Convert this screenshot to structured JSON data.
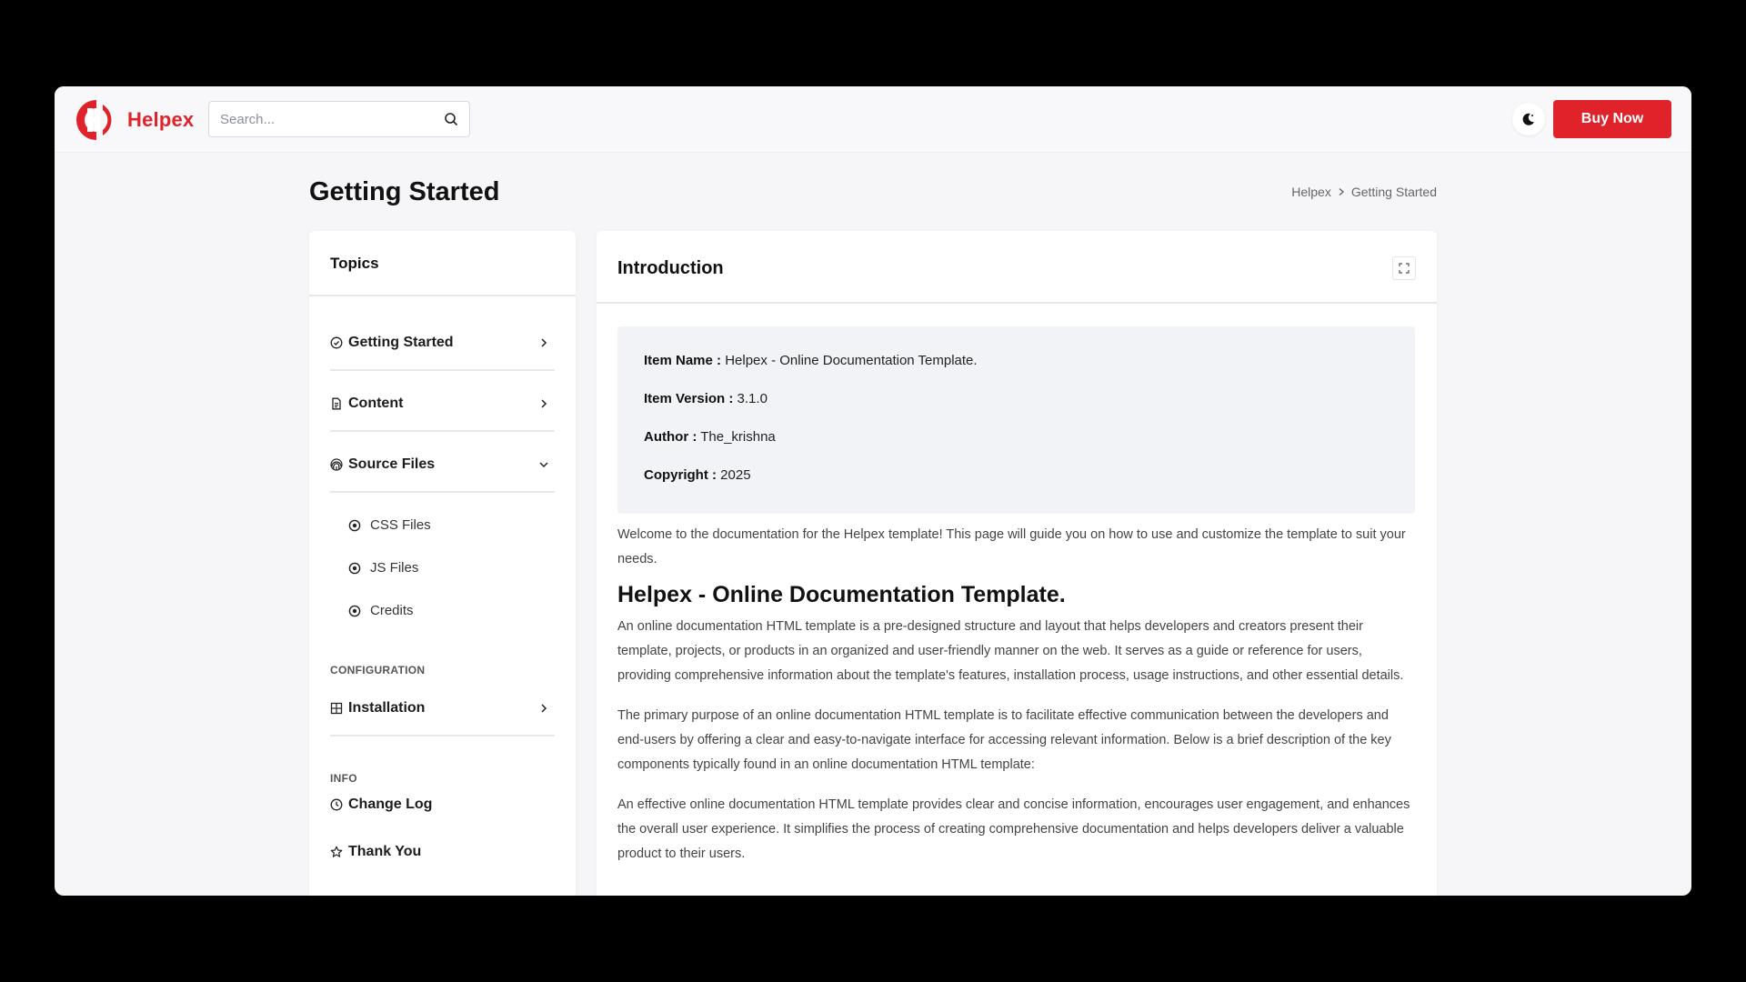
{
  "header": {
    "brand": "Helpex",
    "search_placeholder": "Search...",
    "buy_label": "Buy Now",
    "colors": {
      "accent": "#e0232b"
    }
  },
  "page": {
    "title": "Getting Started",
    "breadcrumb": [
      "Helpex",
      "Getting Started"
    ]
  },
  "sidebar": {
    "title": "Topics",
    "items": [
      {
        "label": "Getting Started",
        "icon": "clock-check-icon",
        "chevron": "chevron-right-icon"
      },
      {
        "label": "Content",
        "icon": "document-icon",
        "chevron": "chevron-right-icon"
      },
      {
        "label": "Source Files",
        "icon": "fingerprint-icon",
        "chevron": "chevron-down-icon"
      }
    ],
    "subitems": [
      {
        "label": "CSS Files"
      },
      {
        "label": "JS Files"
      },
      {
        "label": "Credits"
      }
    ],
    "sections": [
      {
        "label": "CONFIGURATION"
      },
      {
        "label": "INFO"
      }
    ],
    "config_items": [
      {
        "label": "Installation",
        "icon": "grid-icon",
        "chevron": "chevron-right-icon"
      }
    ],
    "info_items": [
      {
        "label": "Change Log",
        "icon": "clock-icon"
      },
      {
        "label": "Thank You",
        "icon": "star-icon"
      }
    ]
  },
  "main": {
    "title": "Introduction",
    "info": [
      {
        "label": "Item Name :",
        "value": "Helpex - Online Documentation Template."
      },
      {
        "label": "Item Version :",
        "value": "3.1.0"
      },
      {
        "label": "Author :",
        "value": "The_krishna"
      },
      {
        "label": "Copyright :",
        "value": "2025"
      }
    ],
    "welcome": "Welcome to the documentation for the Helpex template! This page will guide you on how to use and customize the template to suit your needs.",
    "heading": "Helpex - Online Documentation Template.",
    "paragraphs": [
      "An online documentation HTML template is a pre-designed structure and layout that helps developers and creators present their template, projects, or products in an organized and user-friendly manner on the web. It serves as a guide or reference for users, providing comprehensive information about the template's features, installation process, usage instructions, and other essential details.",
      "The primary purpose of an online documentation HTML template is to facilitate effective communication between the developers and end-users by offering a clear and easy-to-navigate interface for accessing relevant information. Below is a brief description of the key components typically found in an online documentation HTML template:",
      "An effective online documentation HTML template provides clear and concise information, encourages user engagement, and enhances the overall user experience. It simplifies the process of creating comprehensive documentation and helps developers deliver a valuable product to their users."
    ]
  }
}
